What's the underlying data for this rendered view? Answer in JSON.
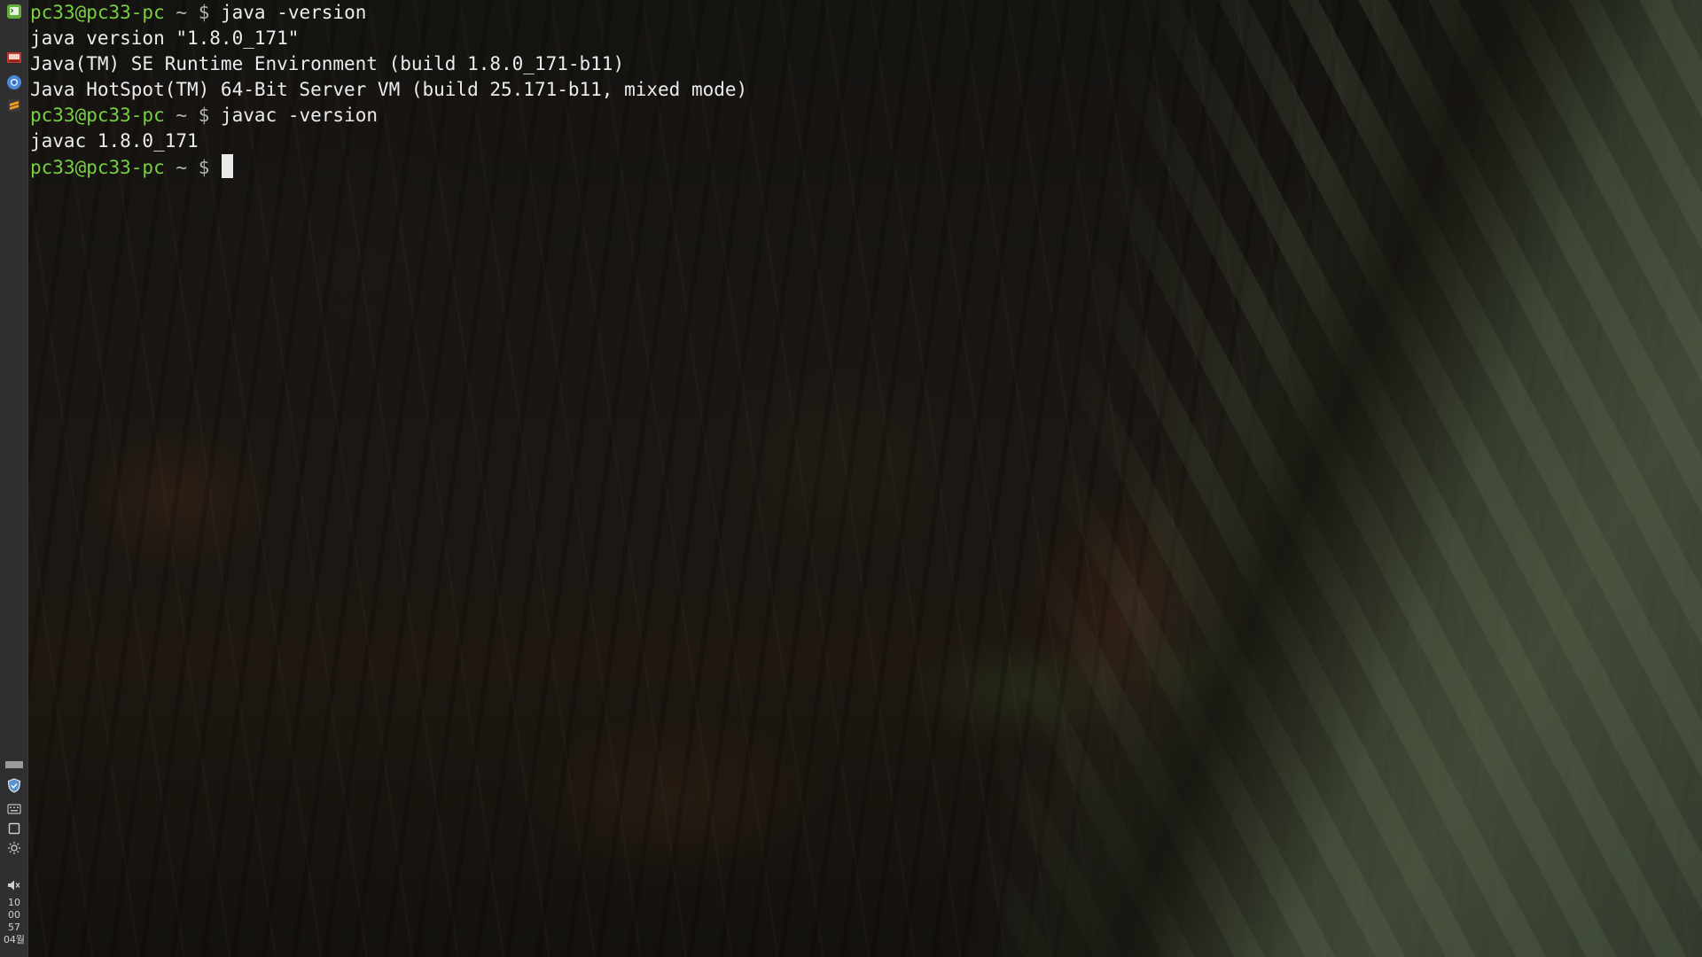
{
  "terminal": {
    "prompt_user": "pc33@pc33-pc",
    "prompt_path": "~",
    "prompt_symbol": "$",
    "lines": [
      {
        "type": "command",
        "text": "java -version"
      },
      {
        "type": "output",
        "text": "java version \"1.8.0_171\""
      },
      {
        "type": "output",
        "text": "Java(TM) SE Runtime Environment (build 1.8.0_171-b11)"
      },
      {
        "type": "output",
        "text": "Java HotSpot(TM) 64-Bit Server VM (build 25.171-b11, mixed mode)"
      },
      {
        "type": "command",
        "text": "javac -version"
      },
      {
        "type": "output",
        "text": "javac 1.8.0_171"
      },
      {
        "type": "command",
        "text": ""
      }
    ]
  },
  "panel": {
    "launchers": [
      {
        "name": "terminal-launcher",
        "icon": "terminal-icon",
        "color": "#5fae3a"
      },
      {
        "name": "media-launcher",
        "icon": "media-icon",
        "color": "#c0392b"
      },
      {
        "name": "chromium-launcher",
        "icon": "chromium-icon",
        "color": "#4a88d8"
      },
      {
        "name": "sublime-launcher",
        "icon": "sublime-icon",
        "color": "#f29a1d"
      }
    ],
    "tray": [
      {
        "name": "window-list",
        "icon": "window-bar-icon"
      },
      {
        "name": "shield",
        "icon": "shield-icon"
      },
      {
        "name": "keyboard",
        "icon": "keyboard-icon"
      },
      {
        "name": "clipboard",
        "icon": "clipboard-icon"
      },
      {
        "name": "settings",
        "icon": "brightness-icon"
      },
      {
        "name": "volume",
        "icon": "volume-icon"
      }
    ],
    "clock": {
      "hour": "10",
      "minute": "00",
      "second": "57",
      "date": "04월"
    }
  }
}
